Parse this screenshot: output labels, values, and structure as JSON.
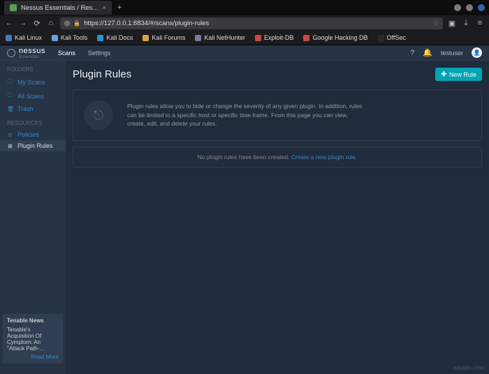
{
  "browser": {
    "tab_title": "Nessus Essentials / Res...",
    "url": "https://127.0.0.1:8834/#/scans/plugin-rules",
    "bookmarks": [
      {
        "label": "Kali Linux",
        "color": "#4a78c3"
      },
      {
        "label": "Kali Tools",
        "color": "#6aa3d8"
      },
      {
        "label": "Kali Docs",
        "color": "#2a96d6"
      },
      {
        "label": "Kali Forums",
        "color": "#d9a24a"
      },
      {
        "label": "Kali NetHunter",
        "color": "#7a7aa0"
      },
      {
        "label": "Exploit-DB",
        "color": "#c34a4a"
      },
      {
        "label": "Google Hacking DB",
        "color": "#c34a4a"
      },
      {
        "label": "OffSec",
        "color": "#2a2a2a"
      }
    ]
  },
  "header": {
    "brand": "nessus",
    "brand_sub": "Essentials",
    "nav": {
      "scans": "Scans",
      "settings": "Settings"
    },
    "user": "testuser"
  },
  "sidebar": {
    "folders_heading": "FOLDERS",
    "folders": [
      {
        "icon": "🗀",
        "label": "My Scans"
      },
      {
        "icon": "🗀",
        "label": "All Scans"
      },
      {
        "icon": "🗑",
        "label": "Trash"
      }
    ],
    "resources_heading": "RESOURCES",
    "resources": [
      {
        "icon": "⊙",
        "label": "Policies",
        "active": false
      },
      {
        "icon": "⊞",
        "label": "Plugin Rules",
        "active": true
      }
    ],
    "news": {
      "heading": "Tenable News",
      "title": "Tenable's Acquisition Of Cymptom: An \"Attack Path-...",
      "more": "Read More"
    }
  },
  "page": {
    "title": "Plugin Rules",
    "new_button": "New Rule",
    "info_text": "Plugin rules allow you to hide or change the severity of any given plugin. In addition, rules can be limited to a specific host or specific time frame. From this page you can view, create, edit, and delete your rules.",
    "empty_prefix": "No plugin rules have been created. ",
    "empty_link": "Create a new plugin rule."
  },
  "watermark": "wsxdn.com"
}
